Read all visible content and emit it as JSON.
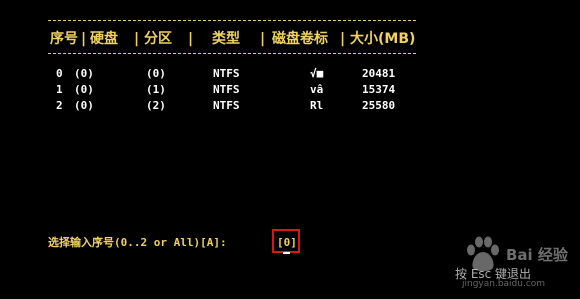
{
  "table": {
    "headers": {
      "index": "序号",
      "disk": "硬盘",
      "partition": "分区",
      "type": "类型",
      "label": "磁盘卷标",
      "size": "大小(MB)"
    },
    "separator": "|",
    "rows": [
      {
        "index": "0",
        "disk": "(0)",
        "partition": "(0)",
        "type": "NTFS",
        "label": "√■",
        "size": "20481"
      },
      {
        "index": "1",
        "disk": "(0)",
        "partition": "(1)",
        "type": "NTFS",
        "label": "vâ",
        "size": "15374"
      },
      {
        "index": "2",
        "disk": "(0)",
        "partition": "(2)",
        "type": "NTFS",
        "label": "Rl",
        "size": "25580"
      }
    ]
  },
  "prompt": {
    "text": "选择输入序号(0..2 or All)[A]:",
    "value": "[0]"
  },
  "footer": {
    "esc_hint": "按 Esc 键退出"
  },
  "watermark": {
    "brand": "Bai 经验",
    "url": "jingyan.baidu.com"
  }
}
